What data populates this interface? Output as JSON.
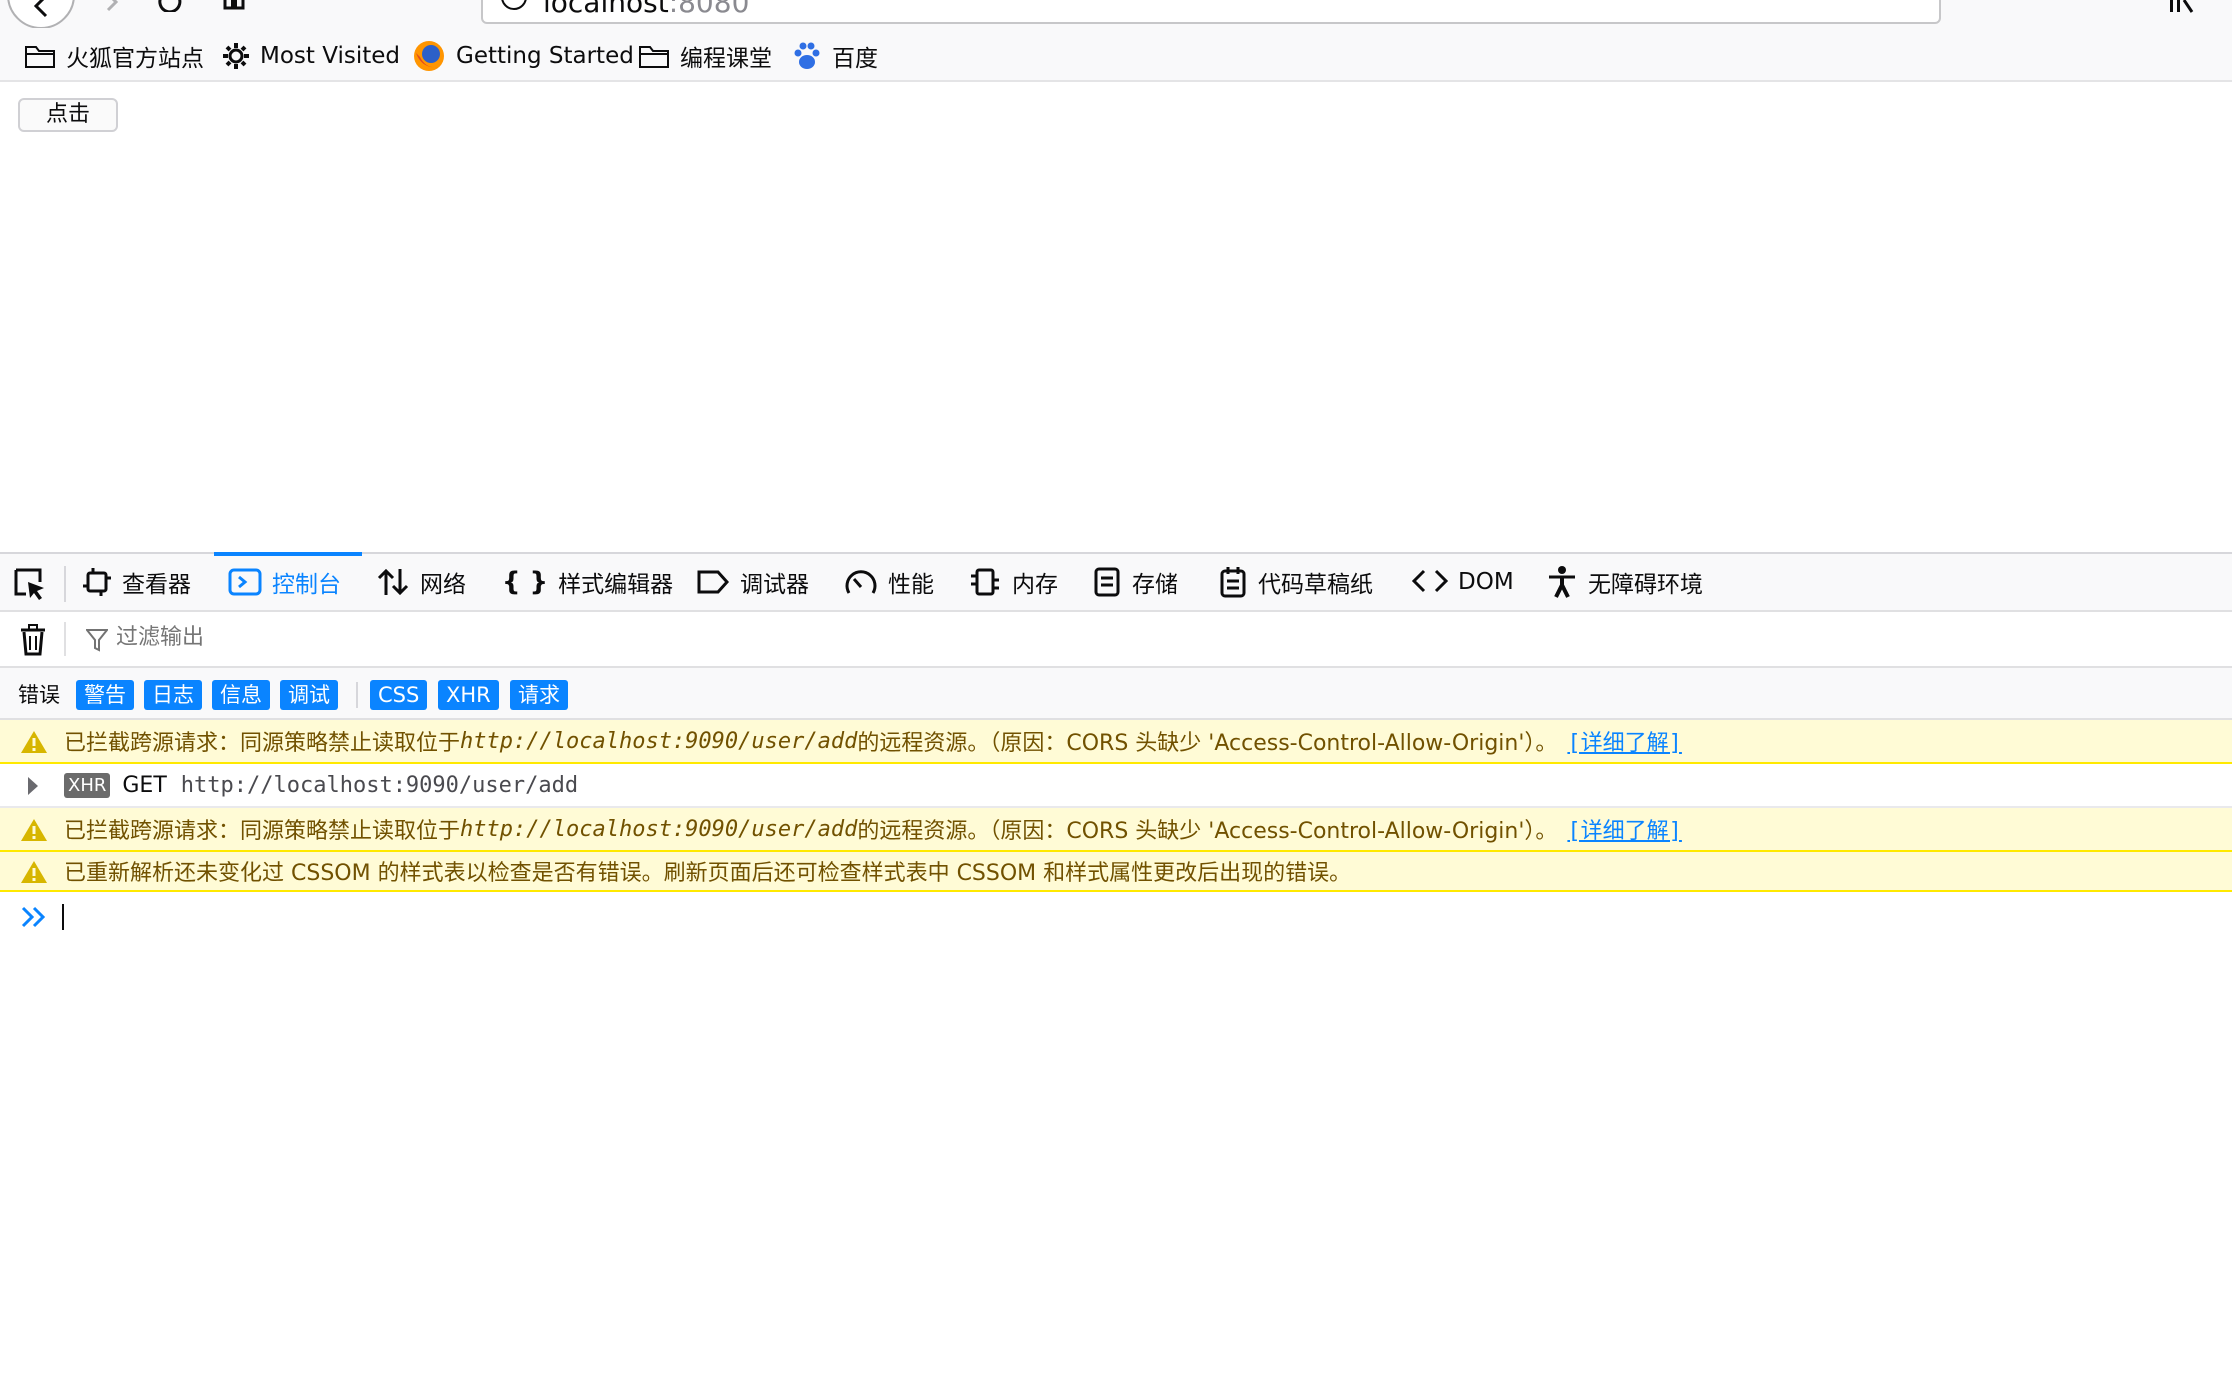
{
  "browser": {
    "url_host": "localhost",
    "url_port": ":8080"
  },
  "bookmarks": [
    {
      "label": "火狐官方站点",
      "icon": "folder-icon"
    },
    {
      "label": "Most Visited",
      "icon": "gear-icon"
    },
    {
      "label": "Getting Started",
      "icon": "firefox-icon"
    },
    {
      "label": "编程课堂",
      "icon": "folder-icon"
    },
    {
      "label": "百度",
      "icon": "baidu-paw-icon"
    }
  ],
  "page": {
    "button_label": "点击"
  },
  "devtools": {
    "tabs": [
      {
        "label": "查看器",
        "icon": "inspector-icon"
      },
      {
        "label": "控制台",
        "icon": "console-icon",
        "active": true
      },
      {
        "label": "网络",
        "icon": "network-icon"
      },
      {
        "label": "样式编辑器",
        "icon": "braces-icon"
      },
      {
        "label": "调试器",
        "icon": "debugger-icon"
      },
      {
        "label": "性能",
        "icon": "gauge-icon"
      },
      {
        "label": "内存",
        "icon": "memory-icon"
      },
      {
        "label": "存储",
        "icon": "storage-icon"
      },
      {
        "label": "代码草稿纸",
        "icon": "scratchpad-icon"
      },
      {
        "label": "DOM",
        "icon": "dom-icon"
      },
      {
        "label": "无障碍环境",
        "icon": "accessibility-icon"
      }
    ],
    "filter_placeholder": "过滤输出",
    "filter_chips": [
      {
        "label": "错误",
        "active": false
      },
      {
        "label": "警告",
        "active": true
      },
      {
        "label": "日志",
        "active": true
      },
      {
        "label": "信息",
        "active": true
      },
      {
        "label": "调试",
        "active": true
      },
      {
        "label": "CSS",
        "active": true
      },
      {
        "label": "XHR",
        "active": true
      },
      {
        "label": "请求",
        "active": true
      }
    ],
    "messages": [
      {
        "type": "warning",
        "prefix": "已拦截跨源请求：同源策略禁止读取位于 ",
        "url": "http://localhost:9090/user/add",
        "suffix": " 的远程资源。（原因：CORS 头缺少 'Access-Control-Allow-Origin'）。",
        "link": "[详细了解]"
      },
      {
        "type": "xhr",
        "badge": "XHR",
        "method": "GET",
        "url": "http://localhost:9090/user/add"
      },
      {
        "type": "warning",
        "prefix": "已拦截跨源请求：同源策略禁止读取位于 ",
        "url": "http://localhost:9090/user/add",
        "suffix": " 的远程资源。（原因：CORS 头缺少 'Access-Control-Allow-Origin'）。",
        "link": "[详细了解]"
      },
      {
        "type": "warning",
        "text": "已重新解析还未变化过 CSSOM 的样式表以检查是否有错误。刷新页面后还可检查样式表中 CSSOM 和样式属性更改后出现的错误。"
      }
    ]
  },
  "colors": {
    "accent": "#0a84ff",
    "warning_bg": "#fffbd6",
    "warning_text": "#715100",
    "warning_icon": "#d7b600"
  }
}
